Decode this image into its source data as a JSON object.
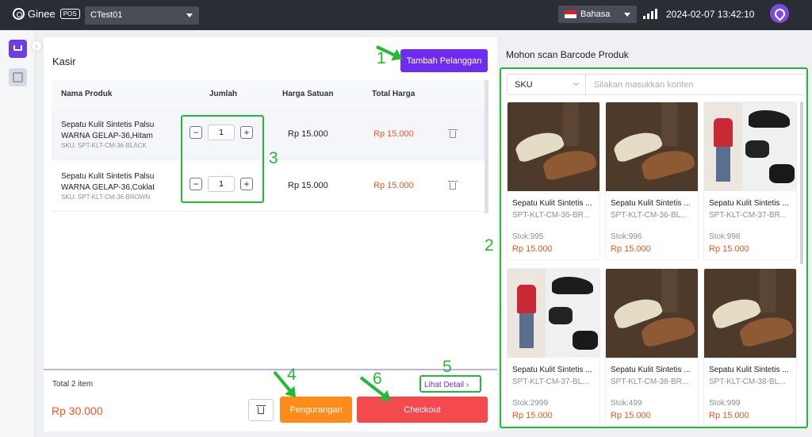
{
  "topbar": {
    "logo_text": "Ginee",
    "logo_badge": "POS",
    "store": "CTest01",
    "language": "Bahasa",
    "datetime": "2024-02-07 13:42:10"
  },
  "cashier": {
    "title": "Kasir",
    "add_customer_label": "Tambah Pelanggan",
    "columns": [
      "Nama Produk",
      "Jumlah",
      "Harga Satuan",
      "Total Harga"
    ],
    "items": [
      {
        "name": "Sepatu Kulit Sintetis Palsu WARNA GELAP-36,Hitam",
        "sku": "SKU: SPT-KLT-CM-36-BLACK",
        "qty": "1",
        "price": "Rp 15.000",
        "total": "Rp 15.000"
      },
      {
        "name": "Sepatu Kulit Sintetis Palsu WARNA GELAP-36,Coklat",
        "sku": "SKU: SPT-KLT-CM-36-BROWN",
        "qty": "1",
        "price": "Rp 15.000",
        "total": "Rp 15.000"
      }
    ],
    "total_items": "Total 2 item",
    "total_amount": "Rp 30.000",
    "detail_label": "Lihat Detail",
    "reduce_label": "Pengurangan",
    "checkout_label": "Checkout"
  },
  "scan": {
    "title": "Mohon scan Barcode Produk",
    "search_type": "SKU",
    "search_placeholder": "Silakan masukkan konten",
    "products": [
      {
        "name": "Sepatu Kulit Sintetis ...",
        "sku": "SPT-KLT-CM-36-BR...",
        "stock": "Stok:995",
        "price": "Rp 15.000",
        "image": "shoe"
      },
      {
        "name": "Sepatu Kulit Sintetis ...",
        "sku": "SPT-KLT-CM-36-BL...",
        "stock": "Stok:996",
        "price": "Rp 15.000",
        "image": "shoe"
      },
      {
        "name": "Sepatu Kulit Sintetis ...",
        "sku": "SPT-KLT-CM-37-BR...",
        "stock": "Stok:998",
        "price": "Rp 15.000",
        "image": "collage"
      },
      {
        "name": "Sepatu Kulit Sintetis ...",
        "sku": "SPT-KLT-CM-37-BL...",
        "stock": "Stok:2999",
        "price": "Rp 15.000",
        "image": "collage"
      },
      {
        "name": "Sepatu Kulit Sintetis ...",
        "sku": "SPT-KLT-CM-38-BR...",
        "stock": "Stok:499",
        "price": "Rp 15.000",
        "image": "shoe"
      },
      {
        "name": "Sepatu Kulit Sintetis ...",
        "sku": "SPT-KLT-CM-38-BL...",
        "stock": "Stok:999",
        "price": "Rp 15.000",
        "image": "shoe"
      }
    ]
  },
  "annotations": [
    "1",
    "2",
    "3",
    "4",
    "5",
    "6"
  ],
  "colors": {
    "accent": "#6d2cf0",
    "checkout": "#f4494d",
    "reduce": "#ff8c1a",
    "price": "#f5561e",
    "annotation": "#22bb33"
  }
}
